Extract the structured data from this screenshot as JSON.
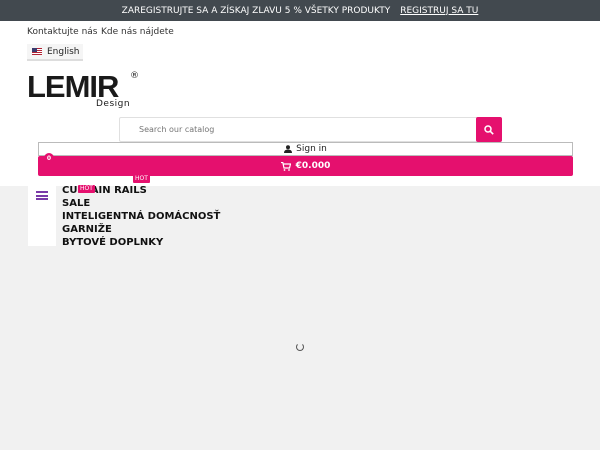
{
  "topbar": {
    "promo_text": "ZAREGISTRUJTE SA A ZÍSKAJ ZLAVU 5 % VŠETKY PRODUKTY",
    "register_link": "REGISTRUJ SA TU"
  },
  "nav": {
    "contact": "Kontaktujte nás",
    "find_us": "Kde nás nájdete"
  },
  "language": {
    "selected": "English"
  },
  "logo": {
    "main": "LEMIR",
    "reg": "®",
    "sub": "Design"
  },
  "search": {
    "placeholder": "Search our catalog"
  },
  "account": {
    "signin_label": "Sign in"
  },
  "cart": {
    "count": "0",
    "total": "€0.000"
  },
  "menu": {
    "items": [
      {
        "label": "CURTAIN RAILS",
        "badge": "HOT"
      },
      {
        "label": "SALE"
      },
      {
        "label": "INTELIGENTNÁ DOMÁCNOSŤ"
      },
      {
        "label": "GARNIŽE"
      },
      {
        "label": "BYTOVÉ DOPLNKY"
      }
    ],
    "badge_top": "HOT"
  },
  "colors": {
    "accent": "#e5106e",
    "topbar": "#42494f",
    "menu_icon": "#7a3aa8"
  },
  "icons": {
    "search": "search-icon",
    "user": "user-icon",
    "cart": "cart-icon",
    "menu": "hamburger-icon",
    "loading": "spinner-icon"
  }
}
